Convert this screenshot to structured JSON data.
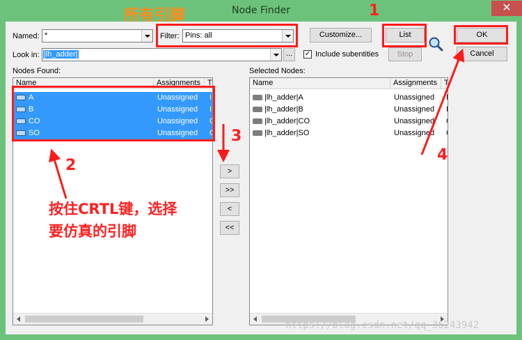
{
  "window": {
    "title": "Node Finder",
    "close_glyph": "✕"
  },
  "named": {
    "label": "Named:",
    "value": "*"
  },
  "filter": {
    "label": "Filter:",
    "value": "Pins: all"
  },
  "look_in": {
    "label": "Look in:",
    "value": "|lh_adder|",
    "browse_label": "..."
  },
  "include_subentities": {
    "label": "Include subentities",
    "checked": true,
    "mark": "✓"
  },
  "buttons": {
    "customize": "Customize...",
    "list": "List",
    "stop": "Stop",
    "ok": "OK",
    "cancel": "Cancel"
  },
  "nodes_found": {
    "label": "Nodes Found:",
    "columns": [
      "Name",
      "Assignments",
      "T"
    ],
    "rows": [
      {
        "name": "A",
        "assign": "Unassigned",
        "extra": "I"
      },
      {
        "name": "B",
        "assign": "Unassigned",
        "extra": "I"
      },
      {
        "name": "CO",
        "assign": "Unassigned",
        "extra": "O"
      },
      {
        "name": "SO",
        "assign": "Unassigned",
        "extra": "O"
      }
    ]
  },
  "transfer": {
    "add": ">",
    "add_all": ">>",
    "remove": "<",
    "remove_all": "<<"
  },
  "selected_nodes": {
    "label": "Selected Nodes:",
    "columns": [
      "Name",
      "Assignments",
      "T"
    ],
    "rows": [
      {
        "name": "|lh_adder|A",
        "assign": "Unassigned",
        "extra": "I"
      },
      {
        "name": "|lh_adder|B",
        "assign": "Unassigned",
        "extra": "I"
      },
      {
        "name": "|lh_adder|CO",
        "assign": "Unassigned",
        "extra": "O"
      },
      {
        "name": "|lh_adder|SO",
        "assign": "Unassigned",
        "extra": "O"
      }
    ]
  },
  "annotations": {
    "all_pins": "所有引脚",
    "n1": "1",
    "n2": "2",
    "n3": "3",
    "n4": "4",
    "hint_line1": "按住CRTL键，选择",
    "hint_line2": "要仿真的引脚"
  },
  "watermark": "https://blog.csdn.net/qq_36243942",
  "colors": {
    "annotation": "#ff1a1a",
    "orange_label": "#ff8a1a",
    "selection": "#3399ff",
    "titlebar": "#6dc27b"
  }
}
